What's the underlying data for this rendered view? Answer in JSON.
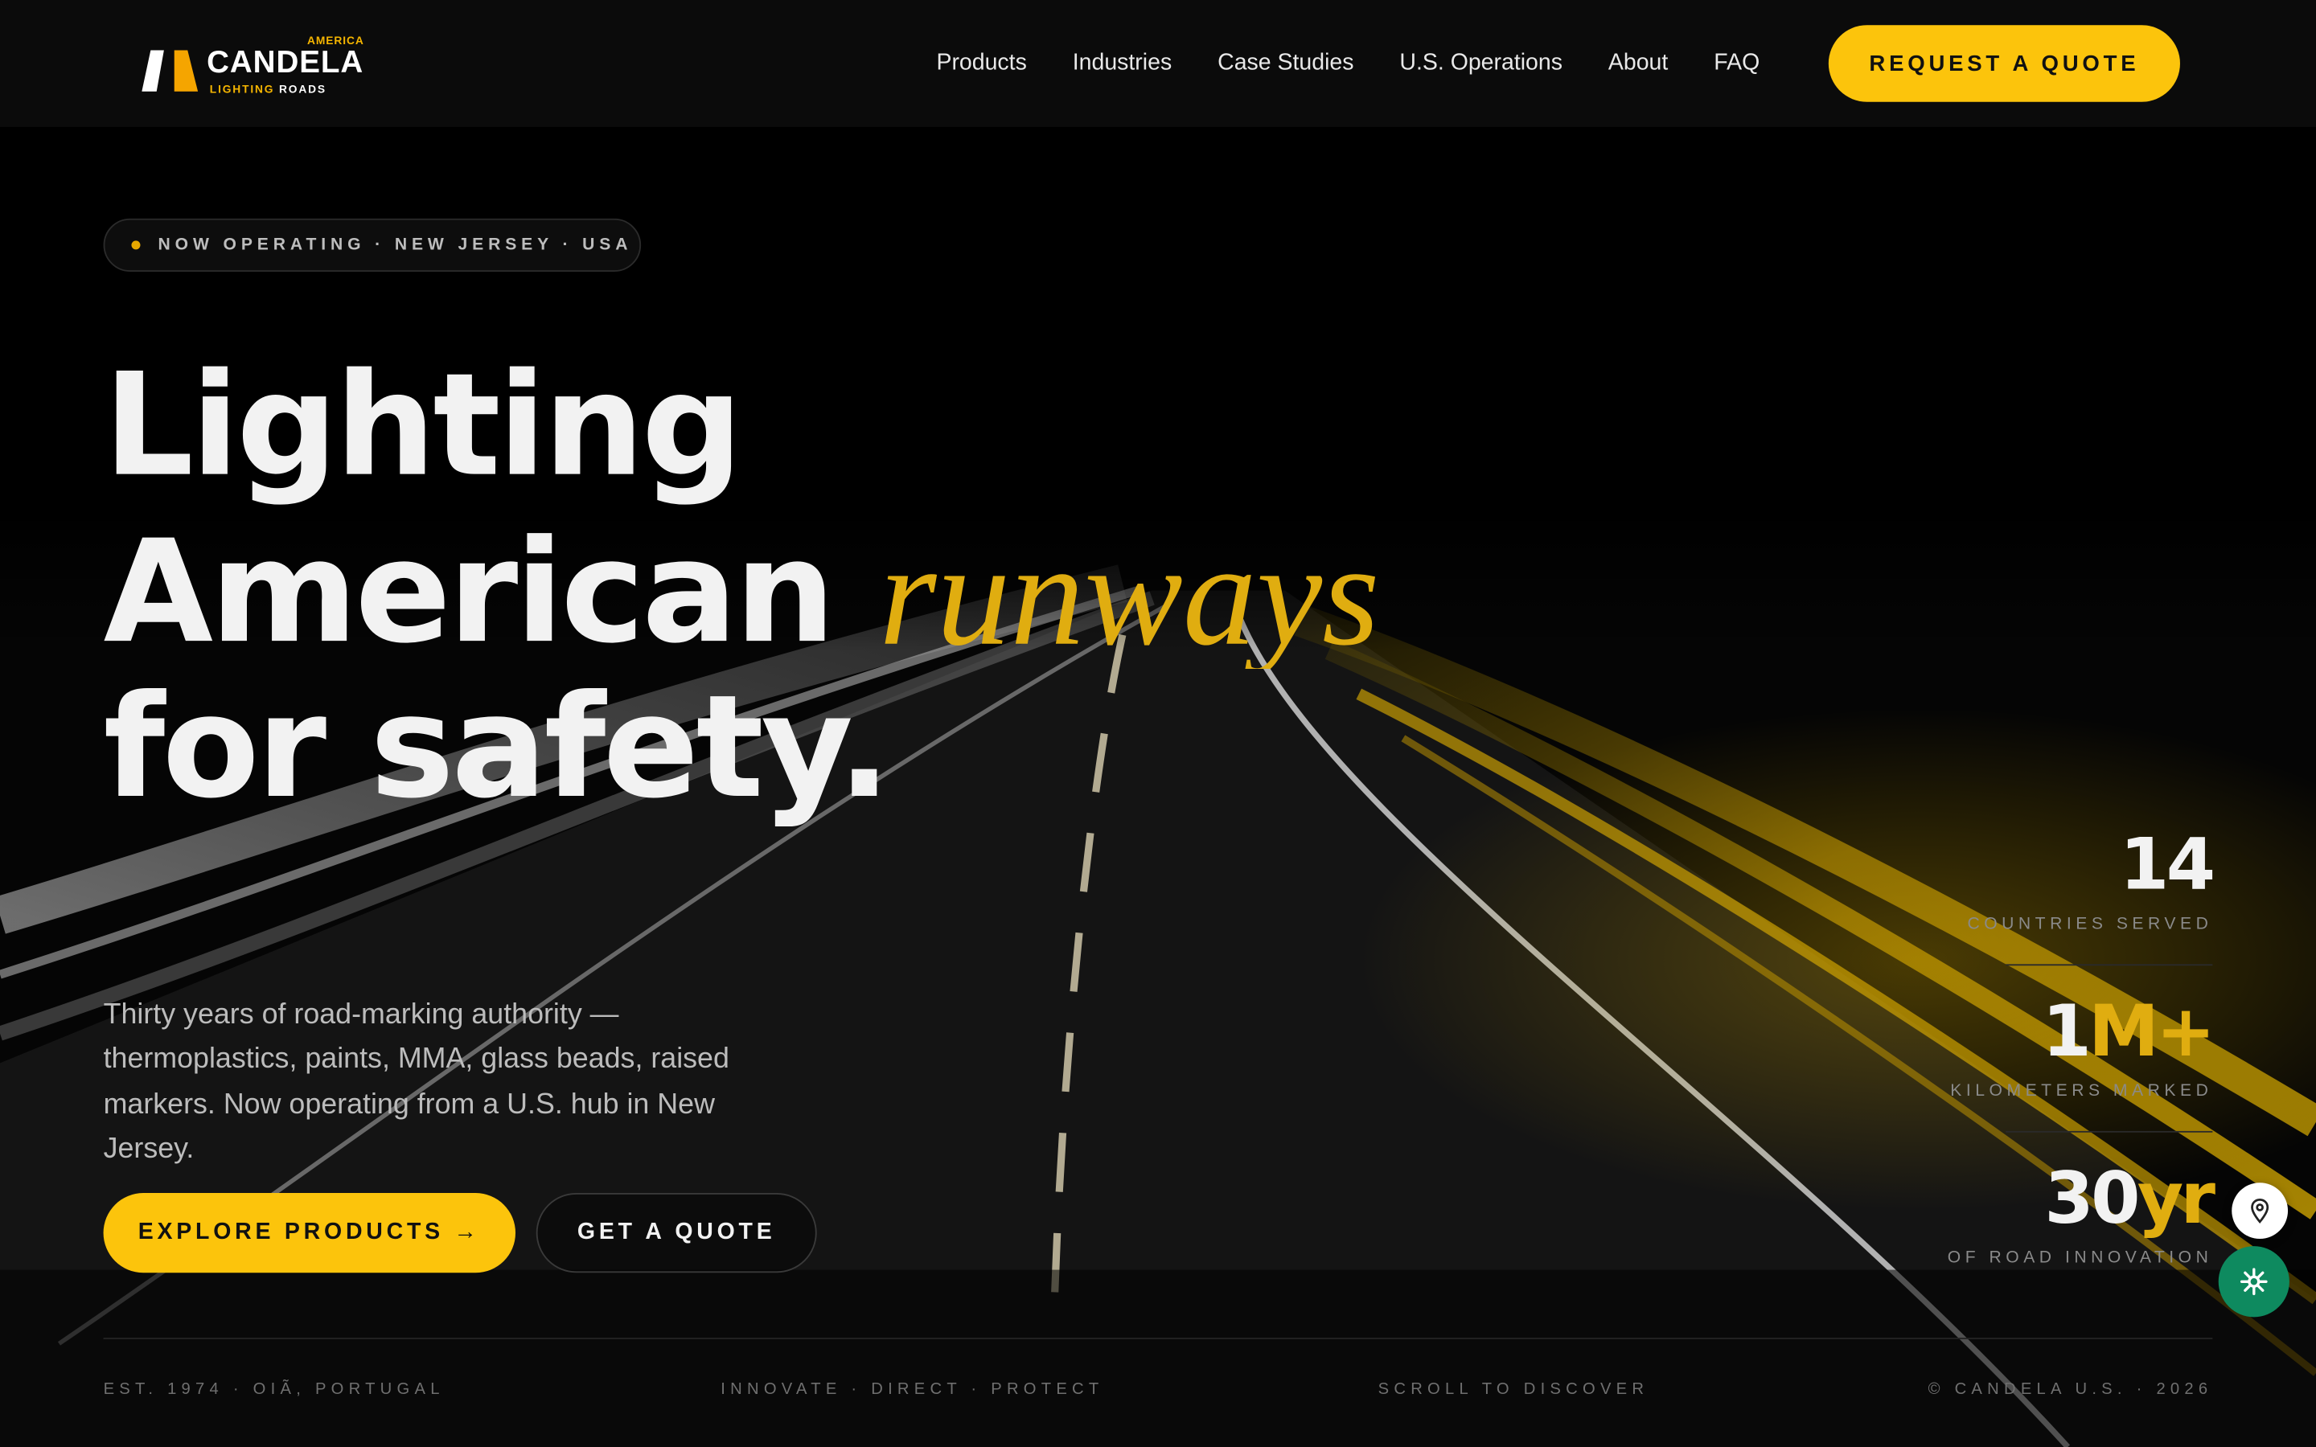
{
  "brand": {
    "country": "AMERICA",
    "name": "CANDELA",
    "tagline_a": "LIGHTING",
    "tagline_b": "ROADS"
  },
  "nav": {
    "items": [
      "Products",
      "Industries",
      "Case Studies",
      "U.S. Operations",
      "About",
      "FAQ"
    ],
    "cta": "REQUEST A QUOTE"
  },
  "hero": {
    "badge": "NOW OPERATING · NEW JERSEY · USA",
    "line1": "Lighting",
    "line2": "American",
    "line2_accent": "runways",
    "line3": "for safety.",
    "lede": "Thirty years of road-marking authority — thermoplastics, paints, MMA, glass beads, raised markers. Now operating from a U.S. hub in New Jersey.",
    "primary_cta": "EXPLORE PRODUCTS →",
    "secondary_cta": "GET A QUOTE"
  },
  "stats": [
    {
      "value": "14",
      "suffix": "",
      "label": "COUNTRIES SERVED"
    },
    {
      "value": "1",
      "suffix": "M+",
      "label": "KILOMETERS MARKED"
    },
    {
      "value": "30",
      "suffix": "yr",
      "label": "OF ROAD INNOVATION"
    }
  ],
  "footer": {
    "est": "EST. 1974 · OIÃ, PORTUGAL",
    "motto": "INNOVATE · DIRECT · PROTECT",
    "scroll": "SCROLL TO DISCOVER",
    "copyright": "© CANDELA U.S. · 2026"
  },
  "colors": {
    "accent": "#fcc40c",
    "accent_text": "#e0ad10",
    "fab_green": "#0e8a5f"
  },
  "icons": {
    "location": "map-pin-icon",
    "assistant": "sparkle-icon",
    "arrow": "arrow-right-icon"
  }
}
